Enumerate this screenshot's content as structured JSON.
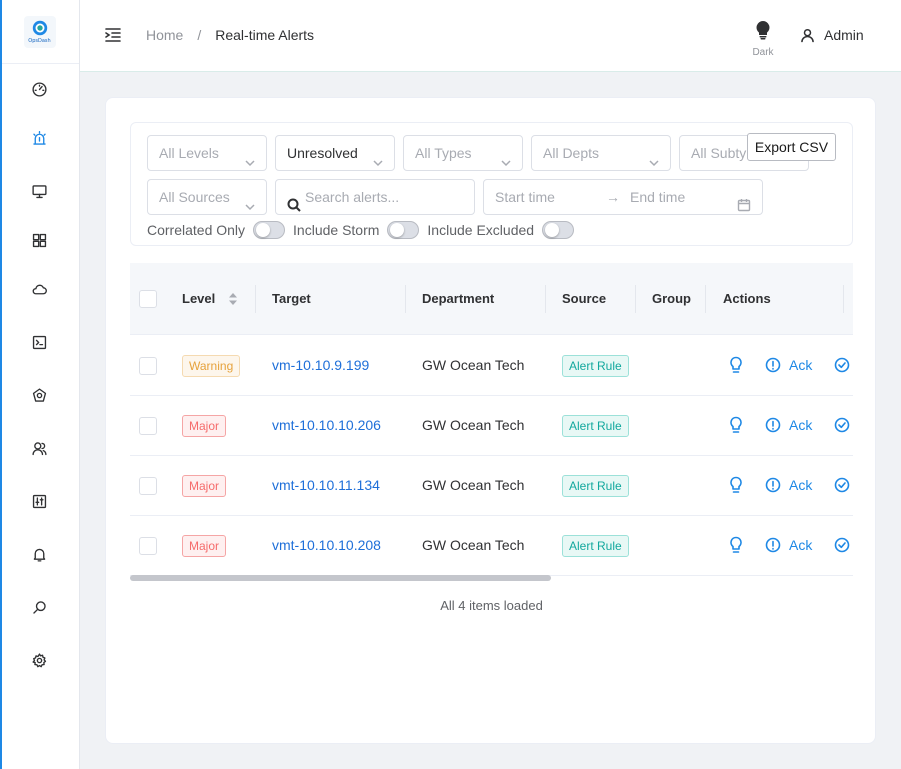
{
  "app": {
    "logo_text": "OpsDash"
  },
  "header": {
    "breadcrumb": {
      "home": "Home",
      "separator": "/",
      "current": "Real-time Alerts"
    },
    "theme_label": "Dark",
    "user_name": "Admin"
  },
  "filters": {
    "level_placeholder": "All Levels",
    "status_value": "Unresolved",
    "type_placeholder": "All Types",
    "dept_placeholder": "All Depts",
    "subtype_placeholder": "All Subty",
    "source_placeholder": "All Sources",
    "search_placeholder": "Search alerts...",
    "start_placeholder": "Start time",
    "range_arrow": "→",
    "end_placeholder": "End time",
    "switches": [
      {
        "label": "Correlated Only",
        "on": false
      },
      {
        "label": "Include Storm",
        "on": false
      },
      {
        "label": "Include Excluded",
        "on": false
      }
    ],
    "export_label": "Export CSV"
  },
  "table": {
    "columns": [
      "Level",
      "Target",
      "Department",
      "Source",
      "Group",
      "Actions"
    ],
    "rows": [
      {
        "level": "Warning",
        "level_type": "warning",
        "target": "vm-10.10.9.199",
        "department": "GW Ocean Tech",
        "source": "Alert Rule",
        "group": "",
        "ack": "Ack"
      },
      {
        "level": "Major",
        "level_type": "major",
        "target": "vmt-10.10.10.206",
        "department": "GW Ocean Tech",
        "source": "Alert Rule",
        "group": "",
        "ack": "Ack"
      },
      {
        "level": "Major",
        "level_type": "major",
        "target": "vmt-10.10.11.134",
        "department": "GW Ocean Tech",
        "source": "Alert Rule",
        "group": "",
        "ack": "Ack"
      },
      {
        "level": "Major",
        "level_type": "major",
        "target": "vmt-10.10.10.208",
        "department": "GW Ocean Tech",
        "source": "Alert Rule",
        "group": "",
        "ack": "Ack"
      }
    ],
    "status": "All 4 items loaded"
  },
  "colors": {
    "accent": "#1e88e5",
    "warning": "#e6a23c",
    "major": "#f56c6c",
    "source_tag": "#13a89e"
  },
  "icons": {
    "sidebar": [
      "dashboard-gauge-icon",
      "alarm-light-icon",
      "monitor-icon",
      "grid-apps-icon",
      "cloud-icon",
      "terminal-icon",
      "cluster-icon",
      "users-icon",
      "tools-icon",
      "bell-icon",
      "search-icon",
      "gear-icon"
    ]
  }
}
